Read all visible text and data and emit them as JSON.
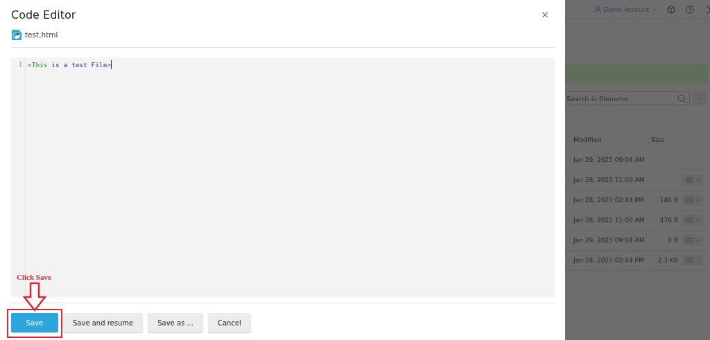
{
  "dialog": {
    "title": "Code Editor",
    "close": "×",
    "file_name": "test.html",
    "editor": {
      "lines": [
        {
          "number": "1",
          "tokens": [
            {
              "text": "<This",
              "kind": "tag"
            },
            {
              "text": " is a test File",
              "kind": "attr"
            },
            {
              "text": ">",
              "kind": "tag"
            }
          ],
          "cursor": true
        }
      ]
    },
    "buttons": [
      {
        "label": "Save",
        "kind": "primary",
        "annotated": true
      },
      {
        "label": "Save and resume",
        "kind": "default"
      },
      {
        "label": "Save as ...",
        "kind": "default"
      },
      {
        "label": "Cancel",
        "kind": "default"
      }
    ]
  },
  "annotation": {
    "text": "Click Save"
  },
  "background": {
    "account": "Demo Account",
    "search": {
      "placeholder": "Search in filename"
    },
    "table": {
      "columns": [
        "Modified",
        "Size"
      ],
      "rows": [
        {
          "modified": "Jan 29, 2025 09:04 AM",
          "menu": false
        },
        {
          "modified": "Jan 28, 2025 11:00 AM",
          "menu": true
        },
        {
          "modified": "Jan 28, 2025 02:44 PM",
          "size": "186 B",
          "menu": true
        },
        {
          "modified": "Jan 28, 2025 11:00 AM",
          "size": "476 B",
          "menu": true
        },
        {
          "modified": "Jan 29, 2025 09:04 AM",
          "size": "0 B",
          "menu": true
        },
        {
          "modified": "Jan 28, 2025 02:44 PM",
          "size": "2.3 KB",
          "menu": true
        }
      ]
    }
  }
}
